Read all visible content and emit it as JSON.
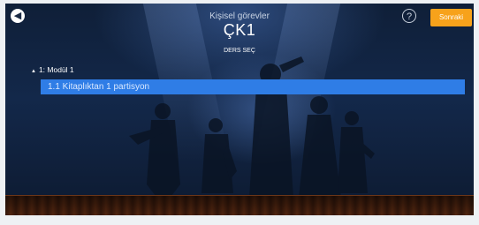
{
  "header": {
    "subtitle": "Kişisel görevler",
    "title": "ÇK1",
    "back_icon": "arrow-left-icon",
    "help_label": "?",
    "next_label": "Sonraki",
    "next_color": "#f7a21b"
  },
  "section": {
    "label": "DERS SEÇ"
  },
  "tree": {
    "module": {
      "expand_icon": "▲",
      "label": "1: Modül 1"
    },
    "selected_item": {
      "label": "1.1 Kitaplıktan 1 partisyon",
      "color": "#2f7de6"
    }
  }
}
